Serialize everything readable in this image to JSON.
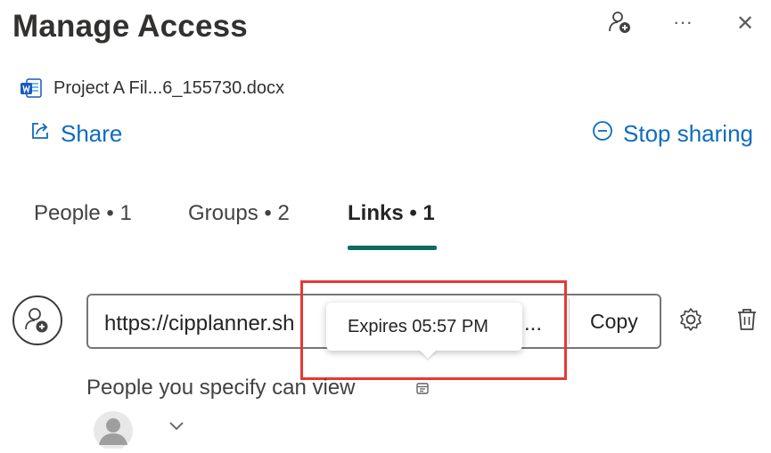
{
  "header": {
    "title": "Manage Access",
    "more_label": "···",
    "close_label": "✕"
  },
  "file": {
    "name": "Project A Fil...6_155730.docx"
  },
  "actions": {
    "share_label": "Share",
    "stop_sharing_label": "Stop sharing"
  },
  "tabs": [
    {
      "label": "People • 1",
      "active": false
    },
    {
      "label": "Groups • 2",
      "active": false
    },
    {
      "label": "Links • 1",
      "active": true
    }
  ],
  "link": {
    "url": "https://cipplanner.sh",
    "tail": "...",
    "copy_label": "Copy",
    "tooltip": "Expires 05:57 PM",
    "permission": "People you specify can view"
  },
  "colors": {
    "accent": "#0f6cbd",
    "tab_underline": "#0e6b62",
    "highlight": "#e53935"
  }
}
